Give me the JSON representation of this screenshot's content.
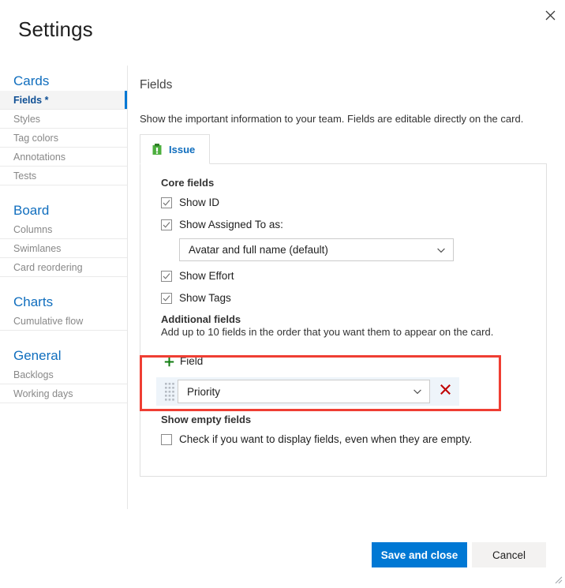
{
  "dialog": {
    "title": "Settings",
    "close_icon": "close-icon",
    "resize_grip_icon": "resize-grip-icon"
  },
  "sidebar": {
    "groups": [
      {
        "header": "Cards",
        "items": [
          {
            "label": "Fields *",
            "selected": true
          },
          {
            "label": "Styles",
            "selected": false
          },
          {
            "label": "Tag colors",
            "selected": false
          },
          {
            "label": "Annotations",
            "selected": false
          },
          {
            "label": "Tests",
            "selected": false
          }
        ]
      },
      {
        "header": "Board",
        "items": [
          {
            "label": "Columns",
            "selected": false
          },
          {
            "label": "Swimlanes",
            "selected": false
          },
          {
            "label": "Card reordering",
            "selected": false
          }
        ]
      },
      {
        "header": "Charts",
        "items": [
          {
            "label": "Cumulative flow",
            "selected": false
          }
        ]
      },
      {
        "header": "General",
        "items": [
          {
            "label": "Backlogs",
            "selected": false
          },
          {
            "label": "Working days",
            "selected": false
          }
        ]
      }
    ]
  },
  "main": {
    "title": "Fields",
    "description": "Show the important information to your team. Fields are editable directly on the card.",
    "tabs": [
      {
        "label": "Issue",
        "icon": "issue-icon",
        "selected": true
      }
    ],
    "core_fields": {
      "heading": "Core fields",
      "show_id": {
        "label": "Show ID",
        "checked": true
      },
      "show_assigned_to": {
        "label": "Show Assigned To as:",
        "checked": true
      },
      "assigned_to_dropdown": {
        "value": "Avatar and full name (default)",
        "chevron_icon": "chevron-down-icon"
      },
      "show_effort": {
        "label": "Show Effort",
        "checked": true
      },
      "show_tags": {
        "label": "Show Tags",
        "checked": true
      }
    },
    "additional_fields": {
      "heading": "Additional fields",
      "description": "Add up to 10 fields in the order that you want them to appear on the card.",
      "add_link": {
        "label": "Field",
        "icon": "plus-icon"
      },
      "rows": [
        {
          "drag_icon": "drag-handle-icon",
          "value": "Priority",
          "chevron_icon": "chevron-down-icon",
          "remove_icon": "close-icon"
        }
      ]
    },
    "show_empty_fields": {
      "heading": "Show empty fields",
      "checkbox_label": "Check if you want to display fields, even when they are empty.",
      "checked": false
    }
  },
  "footer": {
    "save_label": "Save and close",
    "cancel_label": "Cancel"
  },
  "colors": {
    "accent": "#0078d4",
    "link": "#106ebe",
    "highlight": "#ef3e33",
    "issue_green": "#4caf3e",
    "remove_red": "#c00000"
  }
}
